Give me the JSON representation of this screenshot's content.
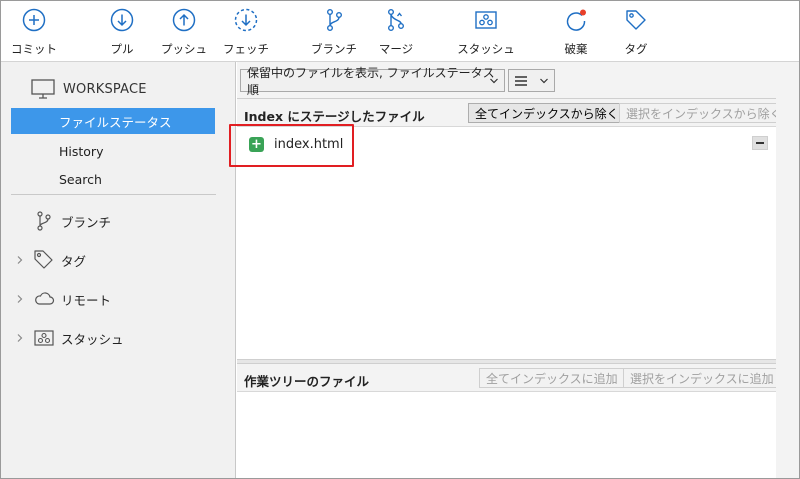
{
  "toolbar": {
    "buttons": [
      {
        "label": "コミット",
        "icon": "commit-plus-icon"
      },
      {
        "label": "プル",
        "icon": "pull-arrow-down-icon"
      },
      {
        "label": "プッシュ",
        "icon": "push-arrow-up-icon"
      },
      {
        "label": "フェッチ",
        "icon": "fetch-dashed-icon"
      },
      {
        "label": "ブランチ",
        "icon": "branch-icon"
      },
      {
        "label": "マージ",
        "icon": "merge-icon"
      },
      {
        "label": "スタッシュ",
        "icon": "stash-icon"
      },
      {
        "label": "破棄",
        "icon": "discard-icon"
      },
      {
        "label": "タグ",
        "icon": "tag-icon"
      }
    ]
  },
  "sidebar": {
    "workspace_label": "WORKSPACE",
    "workspace_items": [
      {
        "label": "ファイルステータス",
        "selected": true
      },
      {
        "label": "History",
        "selected": false
      },
      {
        "label": "Search",
        "selected": false
      }
    ],
    "sections": [
      {
        "label": "ブランチ",
        "icon": "branch-icon",
        "expandable": false
      },
      {
        "label": "タグ",
        "icon": "tag-icon",
        "expandable": true
      },
      {
        "label": "リモート",
        "icon": "cloud-icon",
        "expandable": true
      },
      {
        "label": "スタッシュ",
        "icon": "stash-icon",
        "expandable": true
      }
    ]
  },
  "filter": {
    "view_option": "保留中のファイルを表示, ファイルステータス順",
    "list_mode_icon": "list-icon"
  },
  "staged": {
    "title": "Index にステージしたファイル",
    "unstage_all_label": "全てインデックスから除く",
    "unstage_selected_label": "選択をインデックスから除く",
    "files": [
      {
        "name": "index.html",
        "status": "added"
      }
    ]
  },
  "working": {
    "title": "作業ツリーのファイル",
    "stage_all_label": "全てインデックスに追加",
    "stage_selected_label": "選択をインデックスに追加",
    "files": []
  },
  "colors": {
    "accent": "#3d97ea",
    "icon_blue": "#1f6fc4",
    "added_green": "#3aa357",
    "highlight_red": "#e11e22",
    "discard_dot": "#e8402a"
  }
}
